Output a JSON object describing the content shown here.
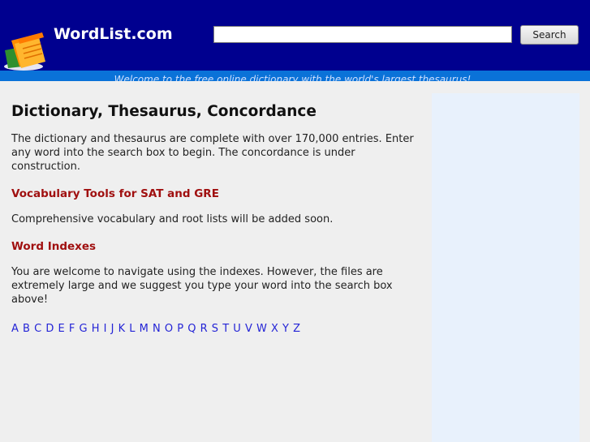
{
  "header": {
    "site_name": "WordList.com",
    "search_placeholder": "",
    "search_value": "",
    "search_button": "Search",
    "tagline": "Welcome to the free online dictionary with the world's largest thesaurus!"
  },
  "colors": {
    "header_bg": "#00008f",
    "tagline_bg": "#0a72d8",
    "heading_red": "#a01010",
    "link_blue": "#2424d6",
    "sidebar_bg": "#e8f1fc"
  },
  "main": {
    "title": "Dictionary, Thesaurus, Concordance",
    "intro": "The dictionary and thesaurus are complete with over 170,000 entries. Enter any word into the search box to begin. The concordance is under construction.",
    "vocab_heading": "Vocabulary Tools for SAT and GRE",
    "vocab_text": "Comprehensive vocabulary and root lists will be added soon.",
    "index_heading": "Word Indexes",
    "index_text": "You are welcome to navigate using the indexes. However, the files are extremely large and we suggest you type your word into the search box above!",
    "letters": [
      "A",
      "B",
      "C",
      "D",
      "E",
      "F",
      "G",
      "H",
      "I",
      "J",
      "K",
      "L",
      "M",
      "N",
      "O",
      "P",
      "Q",
      "R",
      "S",
      "T",
      "U",
      "V",
      "W",
      "X",
      "Y",
      "Z"
    ]
  },
  "icons": {
    "logo": "folder-book-icon"
  }
}
